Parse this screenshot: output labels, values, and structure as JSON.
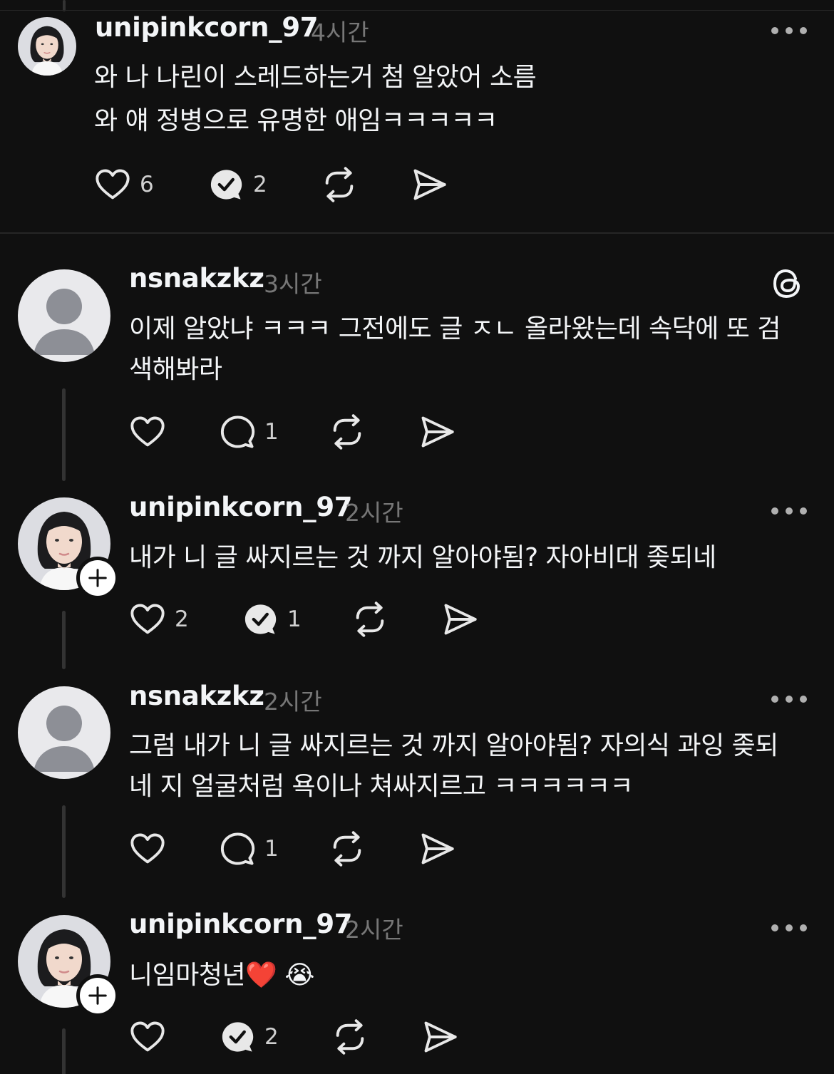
{
  "posts": [
    {
      "username": "unipinkcorn_97",
      "time": "4시간",
      "lines": [
        "와 나 나린이 스레드하는거 첨 알았어 소름",
        "와 얘 정병으로 유명한 애임ㅋㅋㅋㅋㅋ"
      ],
      "likes": "6",
      "replies": "2",
      "reply_icon": "verified-reply-icon"
    },
    {
      "username": "nsnakzkz",
      "time": "3시간",
      "lines": [
        "이제 알았냐 ㅋㅋㅋ 그전에도 글 ㅈㄴ 올라왔는데 속닥에 또 검",
        "색해봐라"
      ],
      "likes": "",
      "replies": "1",
      "reply_icon": "reply-bubble-icon"
    },
    {
      "username": "unipinkcorn_97",
      "time": "2시간",
      "lines": [
        "내가 니 글 싸지르는 것 까지 알아야됨? 자아비대 좆되네"
      ],
      "likes": "2",
      "replies": "1",
      "reply_icon": "verified-reply-icon"
    },
    {
      "username": "nsnakzkz",
      "time": "2시간",
      "lines": [
        "그럼 내가 니 글 싸지르는 것 까지 알아야됨? 자의식 과잉 좆되",
        "네 지 얼굴처럼 욕이나 쳐싸지르고 ㅋㅋㅋㅋㅋㅋ"
      ],
      "likes": "",
      "replies": "1",
      "reply_icon": "reply-bubble-icon"
    },
    {
      "username": "unipinkcorn_97",
      "time": "2시간",
      "lines": [
        "니임마청년"
      ],
      "emoji": "❤️ 😭",
      "likes": "",
      "replies": "2",
      "reply_icon": "verified-reply-icon"
    }
  ],
  "icons": {
    "like": "heart-outline-icon",
    "repost": "repost-icon",
    "share": "send-icon",
    "more": "more-options-icon",
    "app": "threads-logo-icon"
  },
  "colors": {
    "background": "#101010",
    "text": "#f3f5f7",
    "muted": "#777777",
    "divider": "#262626"
  }
}
